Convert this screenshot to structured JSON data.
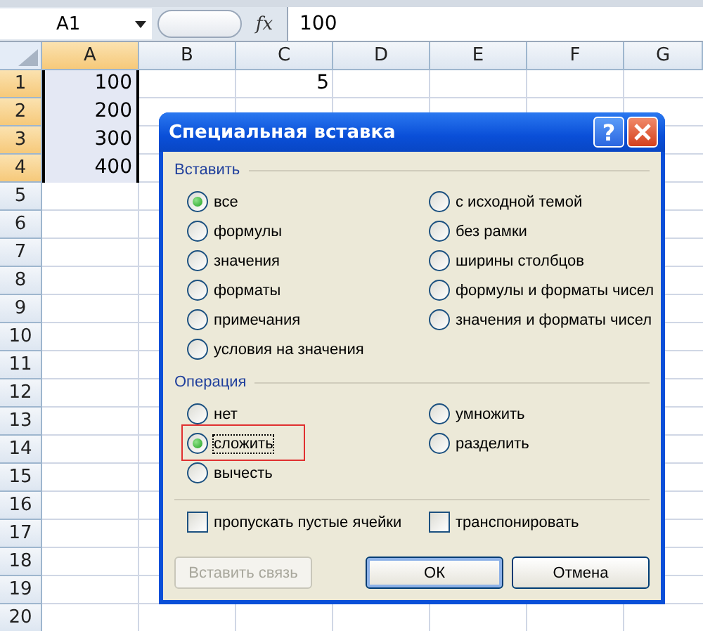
{
  "formula_bar": {
    "name_box": "A1",
    "function_label": "fx",
    "formula": "100"
  },
  "sheet": {
    "columns": [
      {
        "label": "A",
        "selected": true
      },
      {
        "label": "B",
        "selected": false
      },
      {
        "label": "C",
        "selected": false
      },
      {
        "label": "D",
        "selected": false
      },
      {
        "label": "E",
        "selected": false
      },
      {
        "label": "F",
        "selected": false
      },
      {
        "label": "G",
        "selected": false
      }
    ],
    "rows": [
      {
        "label": "1",
        "selected": true,
        "cells": [
          {
            "value": "100",
            "selected": true
          },
          null,
          {
            "value": "5",
            "selected": false
          }
        ]
      },
      {
        "label": "2",
        "selected": true,
        "cells": [
          {
            "value": "200",
            "selected": true
          }
        ]
      },
      {
        "label": "3",
        "selected": true,
        "cells": [
          {
            "value": "300",
            "selected": true
          }
        ]
      },
      {
        "label": "4",
        "selected": true,
        "cells": [
          {
            "value": "400",
            "selected": true
          }
        ]
      },
      {
        "label": "5",
        "selected": false,
        "cells": []
      },
      {
        "label": "6",
        "selected": false,
        "cells": []
      },
      {
        "label": "7",
        "selected": false,
        "cells": []
      },
      {
        "label": "8",
        "selected": false,
        "cells": []
      },
      {
        "label": "9",
        "selected": false,
        "cells": []
      },
      {
        "label": "10",
        "selected": false,
        "cells": []
      },
      {
        "label": "11",
        "selected": false,
        "cells": []
      },
      {
        "label": "12",
        "selected": false,
        "cells": []
      },
      {
        "label": "13",
        "selected": false,
        "cells": []
      },
      {
        "label": "14",
        "selected": false,
        "cells": []
      },
      {
        "label": "15",
        "selected": false,
        "cells": []
      },
      {
        "label": "16",
        "selected": false,
        "cells": []
      },
      {
        "label": "17",
        "selected": false,
        "cells": []
      },
      {
        "label": "18",
        "selected": false,
        "cells": []
      },
      {
        "label": "19",
        "selected": false,
        "cells": []
      },
      {
        "label": "20",
        "selected": false,
        "cells": []
      }
    ]
  },
  "dialog": {
    "title": "Специальная вставка",
    "help_button": "?",
    "paste": {
      "heading": "Вставить",
      "options": [
        {
          "label": "все",
          "selected": true
        },
        {
          "label": "формулы",
          "selected": false
        },
        {
          "label": "значения",
          "selected": false
        },
        {
          "label": "форматы",
          "selected": false
        },
        {
          "label": "примечания",
          "selected": false
        },
        {
          "label": "условия на значения",
          "selected": false
        },
        {
          "label": "с исходной темой",
          "selected": false
        },
        {
          "label": "без рамки",
          "selected": false
        },
        {
          "label": "ширины столбцов",
          "selected": false
        },
        {
          "label": "формулы и форматы чисел",
          "selected": false
        },
        {
          "label": "значения и форматы чисел",
          "selected": false
        }
      ]
    },
    "operation": {
      "heading": "Операция",
      "options": [
        {
          "label": "нет",
          "selected": false,
          "highlighted": false
        },
        {
          "label": "сложить",
          "selected": true,
          "highlighted": true
        },
        {
          "label": "вычесть",
          "selected": false,
          "highlighted": false
        },
        {
          "label": "умножить",
          "selected": false,
          "highlighted": false
        },
        {
          "label": "разделить",
          "selected": false,
          "highlighted": false
        }
      ]
    },
    "checkboxes": [
      {
        "label": "пропускать пустые ячейки",
        "checked": false
      },
      {
        "label": "транспонировать",
        "checked": false
      }
    ],
    "buttons": [
      {
        "label": "Вставить связь",
        "disabled": true,
        "default": false
      },
      {
        "label": "ОК",
        "disabled": false,
        "default": true
      },
      {
        "label": "Отмена",
        "disabled": false,
        "default": false
      }
    ]
  }
}
